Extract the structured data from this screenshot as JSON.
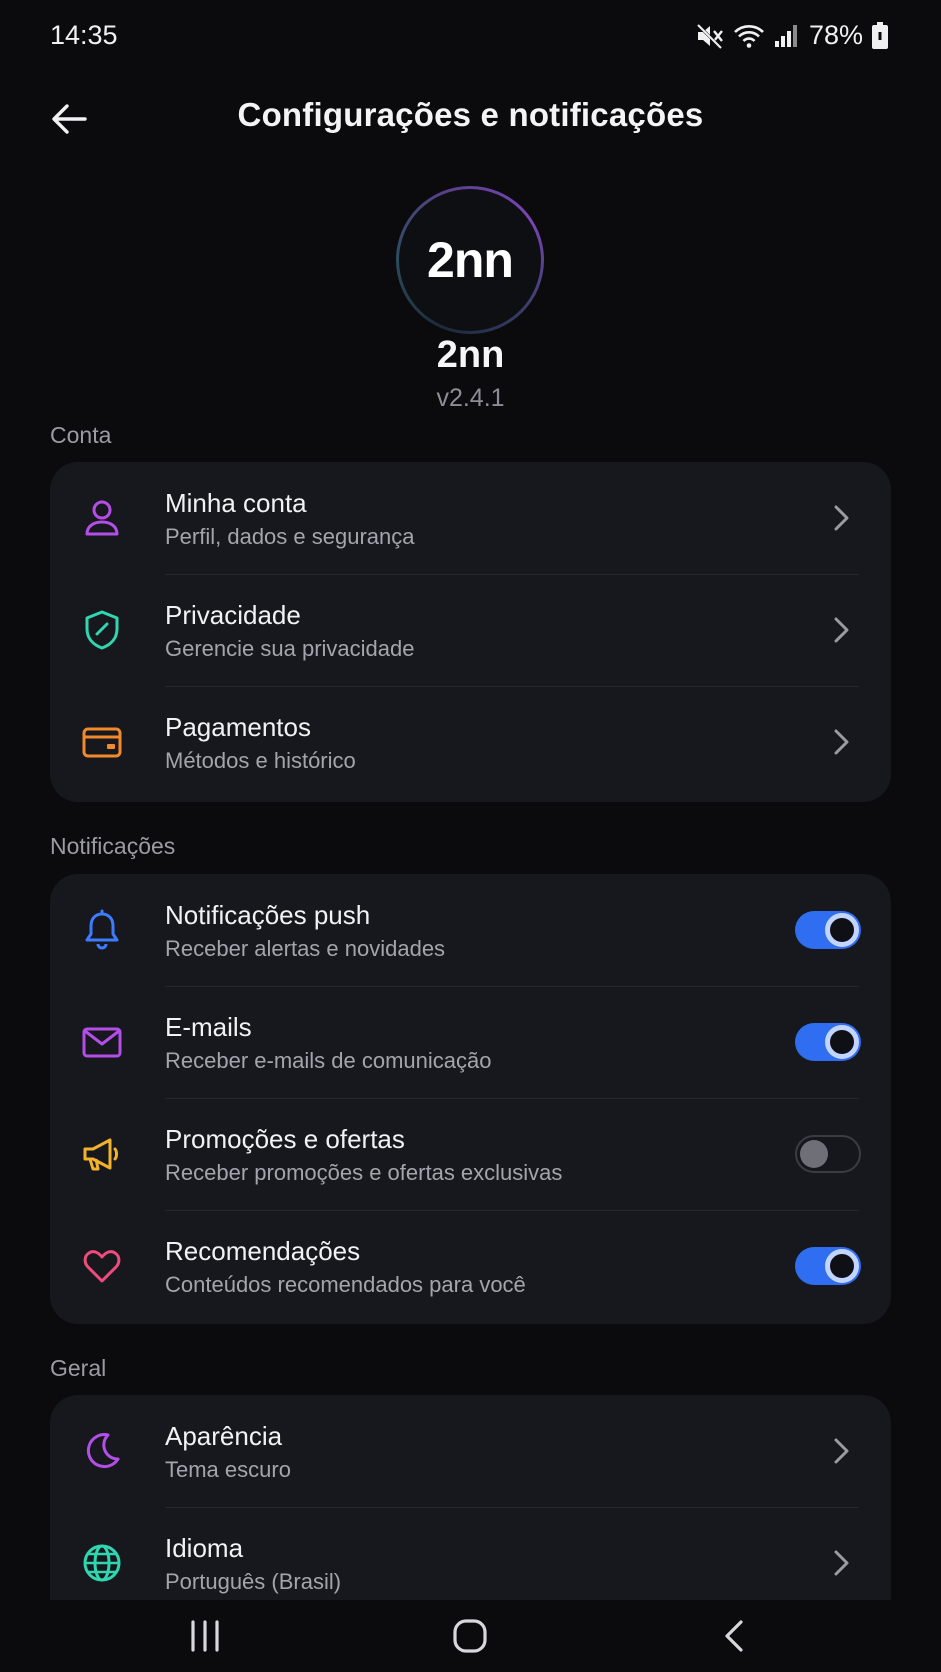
{
  "status_bar": {
    "time": "14:35",
    "battery_percent": "78%",
    "icons": [
      "mute-icon",
      "wifi-icon",
      "signal-icon",
      "battery-icon"
    ]
  },
  "app_bar": {
    "title": "Configurações e notificações",
    "back_icon": "arrow-left-icon"
  },
  "profile": {
    "logo_text": "2nn",
    "name": "2nn",
    "version": "v2.4.1"
  },
  "sections": {
    "account": {
      "label": "Conta",
      "items": [
        {
          "title": "Minha conta",
          "subtitle": "Perfil, dados e segurança",
          "icon": "user-icon",
          "color": "#b44ee8"
        },
        {
          "title": "Privacidade",
          "subtitle": "Gerencie sua privacidade",
          "icon": "shield-icon",
          "color": "#2fd6b0"
        },
        {
          "title": "Pagamentos",
          "subtitle": "Métodos e histórico",
          "icon": "card-icon",
          "color": "#f08a2c"
        }
      ]
    },
    "notifications": {
      "label": "Notificações",
      "items": [
        {
          "title": "Notificações push",
          "subtitle": "Receber alertas e novidades",
          "icon": "bell-icon",
          "color": "#3d7bff",
          "enabled": true
        },
        {
          "title": "E-mails",
          "subtitle": "Receber e-mails de comunicação",
          "icon": "mail-icon",
          "color": "#b44ee8",
          "enabled": true
        },
        {
          "title": "Promoções e ofertas",
          "subtitle": "Receber promoções e ofertas exclusivas",
          "icon": "megaphone-icon",
          "color": "#f2b22b",
          "enabled": false
        },
        {
          "title": "Recomendações",
          "subtitle": "Conteúdos recomendados para você",
          "icon": "heart-icon",
          "color": "#f04b7d",
          "enabled": true
        }
      ]
    },
    "general": {
      "label": "Geral",
      "items": [
        {
          "title": "Aparência",
          "subtitle": "Tema escuro",
          "icon": "moon-icon",
          "color": "#b44ee8"
        },
        {
          "title": "Idioma",
          "subtitle": "Português (Brasil)",
          "icon": "globe-icon",
          "color": "#2fd6b0"
        }
      ]
    }
  },
  "nav_bar": {
    "icons": [
      "recent-apps-icon",
      "home-icon",
      "back-icon"
    ]
  }
}
